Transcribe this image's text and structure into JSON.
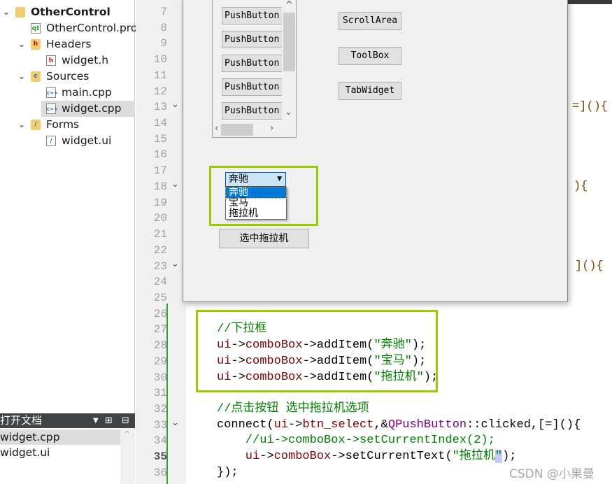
{
  "project_tree": [
    {
      "label": "OtherControl",
      "level": 0,
      "icon": "qt-project-folder-icon",
      "expanded": true,
      "bold": true
    },
    {
      "label": "OtherControl.pro",
      "level": 1,
      "icon": "pro-file-icon"
    },
    {
      "label": "Headers",
      "level": 1,
      "icon": "headers-folder-icon",
      "expanded": true
    },
    {
      "label": "widget.h",
      "level": 2,
      "icon": "header-file-icon"
    },
    {
      "label": "Sources",
      "level": 1,
      "icon": "sources-folder-icon",
      "expanded": true
    },
    {
      "label": "main.cpp",
      "level": 2,
      "icon": "cpp-file-icon"
    },
    {
      "label": "widget.cpp",
      "level": 2,
      "icon": "cpp-file-icon",
      "selected": true
    },
    {
      "label": "Forms",
      "level": 1,
      "icon": "forms-folder-icon",
      "expanded": true
    },
    {
      "label": "widget.ui",
      "level": 2,
      "icon": "ui-file-icon"
    }
  ],
  "open_docs": {
    "title": "打开文档",
    "items": [
      {
        "label": "widget.cpp",
        "selected": true
      },
      {
        "label": "widget.ui"
      }
    ]
  },
  "line_numbers": [
    7,
    8,
    9,
    10,
    11,
    12,
    13,
    14,
    15,
    16,
    17,
    18,
    19,
    20,
    21,
    22,
    23,
    24,
    25,
    26,
    27,
    28,
    29,
    30,
    31,
    32,
    33,
    34,
    35,
    36
  ],
  "current_line": 35,
  "fold_lines": [
    13,
    18,
    23,
    33
  ],
  "partial_code": [
    {
      "line": 13,
      "text": "=](){"
    },
    {
      "line": 18,
      "text": "){"
    },
    {
      "line": 23,
      "text": "](){"
    }
  ],
  "code": [
    {
      "line": 27,
      "indent": 0,
      "tokens": [
        [
          "cmt",
          "//下拉框"
        ]
      ]
    },
    {
      "line": 28,
      "indent": 0,
      "tokens": [
        [
          "member",
          "ui"
        ],
        [
          "plain",
          "->"
        ],
        [
          "member",
          "comboBox"
        ],
        [
          "plain",
          "->addItem("
        ],
        [
          "str",
          "\"奔驰\""
        ],
        [
          "plain",
          ");"
        ]
      ]
    },
    {
      "line": 29,
      "indent": 0,
      "tokens": [
        [
          "member",
          "ui"
        ],
        [
          "plain",
          "->"
        ],
        [
          "member",
          "comboBox"
        ],
        [
          "plain",
          "->addItem("
        ],
        [
          "str",
          "\"宝马\""
        ],
        [
          "plain",
          ");"
        ]
      ]
    },
    {
      "line": 30,
      "indent": 0,
      "tokens": [
        [
          "member",
          "ui"
        ],
        [
          "plain",
          "->"
        ],
        [
          "member",
          "comboBox"
        ],
        [
          "plain",
          "->addItem("
        ],
        [
          "str",
          "\"拖拉机\""
        ],
        [
          "plain",
          ");"
        ]
      ]
    },
    {
      "line": 32,
      "indent": 0,
      "tokens": [
        [
          "cmt",
          "//点击按钮 选中拖拉机选项"
        ]
      ]
    },
    {
      "line": 33,
      "indent": 0,
      "tokens": [
        [
          "plain",
          "connect("
        ],
        [
          "member",
          "ui"
        ],
        [
          "plain",
          "->"
        ],
        [
          "member",
          "btn_select"
        ],
        [
          "plain",
          ",&"
        ],
        [
          "type",
          "QPushButton"
        ],
        [
          "plain",
          "::clicked,[=](){"
        ]
      ]
    },
    {
      "line": 34,
      "indent": 4,
      "tokens": [
        [
          "cmt",
          "//ui->comboBox->setCurrentIndex(2);"
        ]
      ]
    },
    {
      "line": 35,
      "indent": 4,
      "tokens": [
        [
          "member",
          "ui"
        ],
        [
          "plain",
          "->"
        ],
        [
          "member",
          "comboBox"
        ],
        [
          "plain",
          "->setCurrentText("
        ],
        [
          "str",
          "\"拖拉机"
        ],
        [
          "cursor",
          "\""
        ],
        [
          "plain",
          ");"
        ]
      ]
    },
    {
      "line": 36,
      "indent": 0,
      "tokens": [
        [
          "plain",
          "});"
        ]
      ]
    }
  ],
  "widget_window": {
    "scroll_buttons": [
      "PushButton",
      "PushButton",
      "PushButton",
      "PushButton",
      "PushButton"
    ],
    "right_buttons": [
      "ScrollArea",
      "ToolBox",
      "TabWidget"
    ],
    "combo": {
      "current": "奔驰",
      "options": [
        "奔驰",
        "宝马",
        "拖拉机"
      ],
      "highlighted": 0
    },
    "select_button": "选中拖拉机"
  },
  "colors": {
    "highlight_box": "#99cc00",
    "selection": "#0078d7"
  },
  "watermark": "CSDN @小果曼"
}
